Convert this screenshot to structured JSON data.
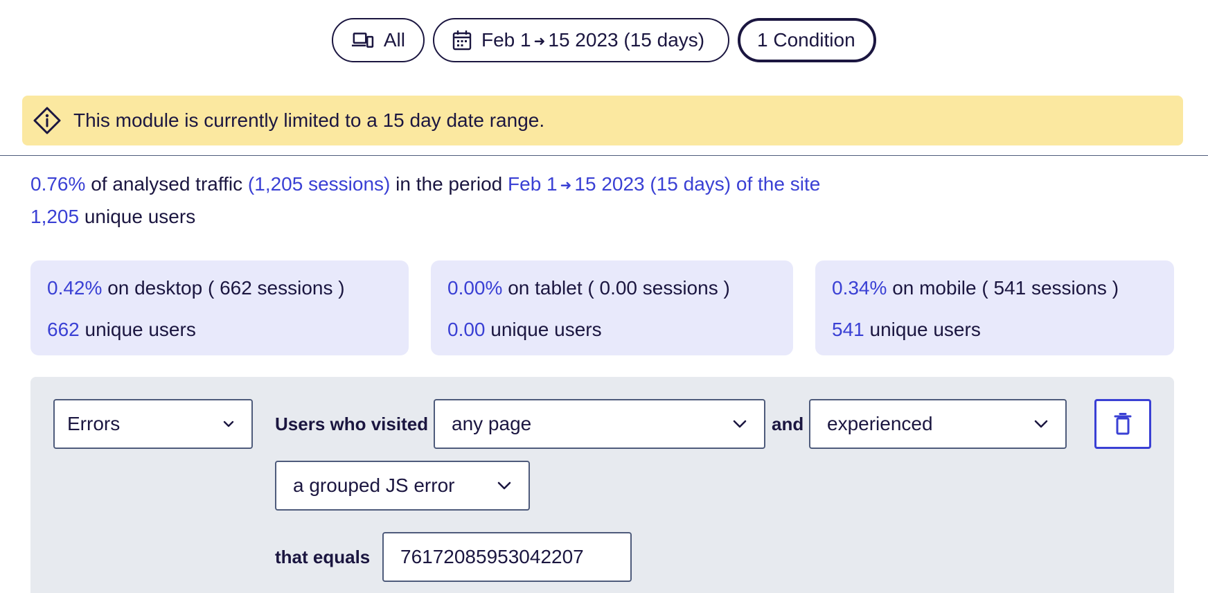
{
  "filters": {
    "device_label": "All",
    "date_range": {
      "start": "Feb 1",
      "arrow": "➜",
      "end": "15 2023 (15 days)"
    },
    "condition_label": "1 Condition"
  },
  "banner": {
    "message": "This module is currently limited to a 15 day date range."
  },
  "summary": {
    "percent": "0.76%",
    "text1": "of analysed traffic",
    "sessions": "(1,205 sessions)",
    "text2": "in the period",
    "period_start": "Feb 1",
    "arrow": "➜",
    "period_end": "15 2023 (15 days) of the site",
    "users": "1,205",
    "users_label": "unique users"
  },
  "devices": [
    {
      "percent": "0.42%",
      "label": "on desktop ( 662 sessions )",
      "users": "662",
      "users_label": "unique users"
    },
    {
      "percent": "0.00%",
      "label": "on tablet ( 0.00 sessions )",
      "users": "0.00",
      "users_label": "unique users"
    },
    {
      "percent": "0.34%",
      "label": "on mobile ( 541 sessions )",
      "users": "541",
      "users_label": "unique users"
    }
  ],
  "condition": {
    "type_value": "Errors",
    "users_visited_label": "Users who visited",
    "page_value": "any page",
    "and_label": "and",
    "experience_value": "experienced",
    "error_type_value": "a grouped JS error",
    "equals_label": "that equals",
    "error_id_value": "76172085953042207"
  },
  "colors": {
    "accent": "#3a40d4",
    "text": "#1b1640",
    "banner_bg": "#fbe8a0",
    "card_bg": "#e8e9fb",
    "panel_bg": "#e7eaef"
  }
}
